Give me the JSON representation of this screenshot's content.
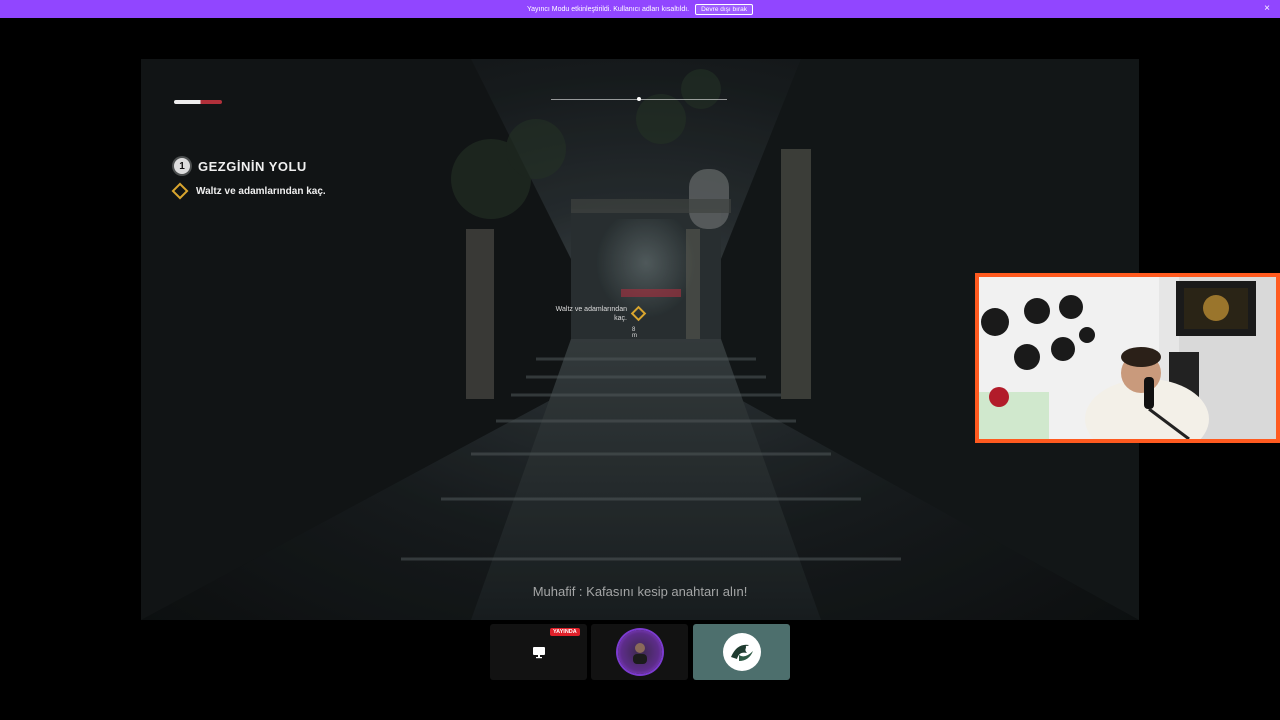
{
  "banner": {
    "message": "Yayıncı Modu etkinleştirildi. Kullanıcı adları kısaltıldı.",
    "disable_label": "Devre dışı bırak",
    "close_glyph": "×",
    "background_color": "#9146ff"
  },
  "game": {
    "quest_number": "1",
    "quest_title": "GEZGİNİN YOLU",
    "objective": "Waltz ve adamlarından kaç.",
    "waypoint_label": "Waltz ve adamlarından kaç.",
    "waypoint_distance": "8 m",
    "subtitle": "Muhafif : Kafasını kesip anahtarı alın!",
    "health_fraction": 0.55,
    "objective_color": "#d9a52e"
  },
  "webcam": {
    "border_color": "#ff5a1f"
  },
  "tiles": [
    {
      "icon": "screen-share-icon",
      "badge": "YAYINDA",
      "badge_color": "#e0202a"
    },
    {
      "icon": "user-avatar-icon"
    },
    {
      "icon": "server-logo-icon",
      "selected": true
    }
  ]
}
